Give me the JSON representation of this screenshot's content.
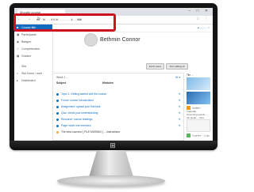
{
  "browser": {
    "tab_title": "Moodle course",
    "url": "e2  · iii . . .  ii ii iii  . . . . . . . ii . . iiiiiii",
    "window_controls": "– □ ✕",
    "nav_buttons": "← → ↻",
    "addr_icons": "☆ ⋮"
  },
  "site": {
    "user_menu": "▴ ......... ○",
    "sidebar": [
      {
        "icon": "■",
        "label": "Course title",
        "active": true
      },
      {
        "icon": "▣",
        "label": "Participants"
      },
      {
        "icon": "◉",
        "label": "Badges"
      },
      {
        "icon": "✓",
        "label": "Competencies"
      },
      {
        "icon": "▦",
        "label": "Grades"
      },
      {
        "icon": "",
        "label": "Site"
      },
      {
        "icon": "⌂",
        "label": "Site home / web"
      },
      {
        "icon": "▸",
        "label": "Dashboard"
      }
    ],
    "course_title": "Bethmin Connor",
    "buttons": [
      "Enrol users",
      "Turn editing on"
    ],
    "card": {
      "head": "Week 1 ...",
      "col1": "Subject",
      "col2": "Modules",
      "tools": "⚙ ▾",
      "rows": [
        "Topic 1: Getting started with the course",
        "Forum: course introductions",
        "Assignment: upload your first task",
        "Quiz: check your understanding",
        "Resource: course readings",
        "Page: week one overview"
      ],
      "last_row": "The intra courses: [ FILE MISSING ] ... instructions"
    },
    "right_blocks": {
      "title": "Tile ...",
      "text1": "Update / Calendar",
      "text2": "Upcoming events ... the week ... here",
      "text3": "Courses  ...  [ ] go"
    }
  },
  "colors": {
    "accent": "#0f6cbf",
    "highlight": "#d0101c"
  }
}
